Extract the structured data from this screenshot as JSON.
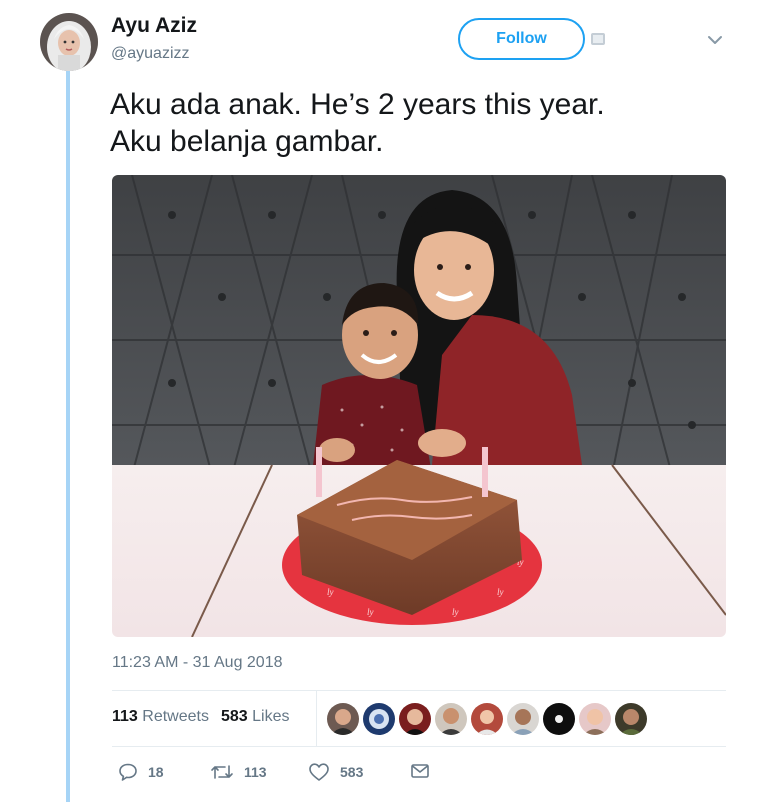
{
  "author": {
    "display_name": "Ayu Aziz",
    "handle": "@ayuazizz",
    "avatar": "profile-photo-woman-in-white-hijab"
  },
  "header": {
    "follow_label": "Follow",
    "menu_icon": "chevron-down-icon"
  },
  "tweet": {
    "text_lines": [
      "Aku ada anak. He’s 2 years this year.",
      "Aku belanja gambar."
    ],
    "photo": "woman-in-black-hijab-and-toddler-with-chocolate-birthday-cake",
    "timestamp": "11:23 AM - 31 Aug 2018"
  },
  "stats": {
    "retweets_count": "113",
    "retweets_label": "Retweets",
    "likes_count": "583",
    "likes_label": "Likes",
    "liker_avatars": 9
  },
  "actions": {
    "reply_count": "18",
    "retweet_count": "113",
    "like_count": "583"
  },
  "colors": {
    "accent": "#1da1f2",
    "thread_line": "#a6d4f6",
    "muted_text": "#657786"
  }
}
